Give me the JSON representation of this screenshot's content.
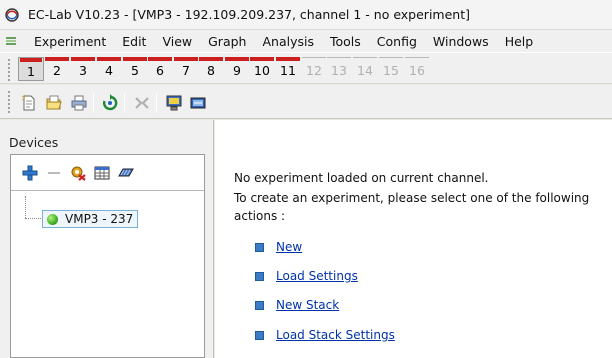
{
  "window": {
    "title": "EC-Lab V10.23 - [VMP3 - 192.109.209.237, channel 1 - no experiment]"
  },
  "menu": {
    "items": [
      "Experiment",
      "Edit",
      "View",
      "Graph",
      "Analysis",
      "Tools",
      "Config",
      "Windows",
      "Help"
    ]
  },
  "channels": {
    "active": "1",
    "enabled": [
      "1",
      "2",
      "3",
      "4",
      "5",
      "6",
      "7",
      "8",
      "9",
      "10",
      "11"
    ],
    "disabled": [
      "12",
      "13",
      "14",
      "15",
      "16"
    ]
  },
  "toolbar": {
    "icons": [
      "new-file-icon",
      "open-folder-icon",
      "print-icon",
      "refresh-icon",
      "disconnect-icon",
      "computer-icon",
      "monitor-icon"
    ]
  },
  "devices": {
    "label": "Devices",
    "tools": [
      "add-icon",
      "remove-icon",
      "settings-icon",
      "table-icon",
      "connect-icon"
    ],
    "node": "VMP3 - 237"
  },
  "main": {
    "line1": "No experiment loaded on current channel.",
    "line2": "To create an experiment, please select one of the following",
    "line3": "actions :",
    "actions": [
      "New",
      "Load Settings",
      "New Stack",
      "Load Stack Settings"
    ]
  },
  "colors": {
    "channel_mark": "#cc2020",
    "link": "#0033aa",
    "bullet": "#3c7cc4",
    "device_status": "#3cb020"
  }
}
